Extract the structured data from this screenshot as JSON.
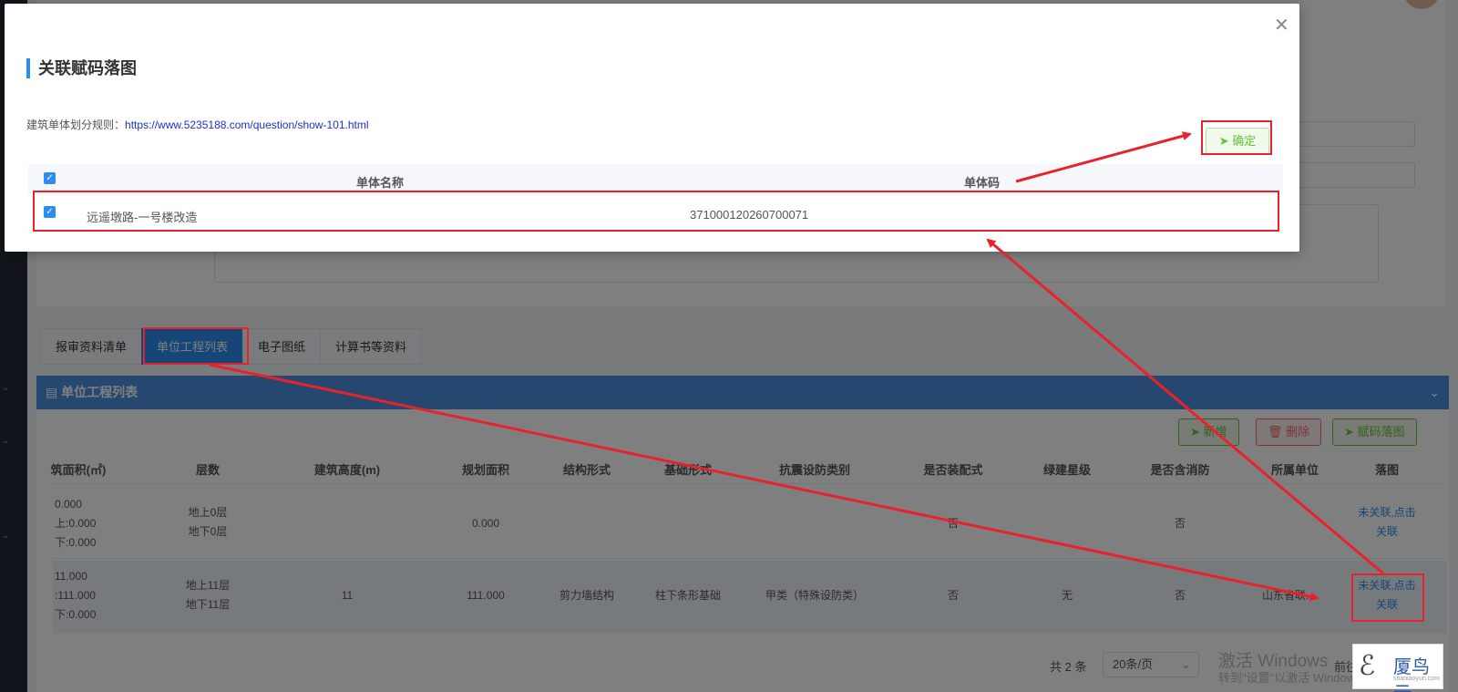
{
  "modal": {
    "title": "关联赋码落图",
    "close_icon": "close-icon",
    "rule_label": "建筑单体划分规则：",
    "rule_url": "https://www.5235188.com/question/show-101.html",
    "confirm_label": "确定",
    "confirm_icon": "send-icon",
    "columns": [
      "单体名称",
      "单体码"
    ],
    "rows": [
      {
        "name": "远遥墩路-一号楼改造",
        "code": "371000120260700071",
        "checked": true
      }
    ]
  },
  "tabs": [
    {
      "label": "报审资料清单",
      "active": false
    },
    {
      "label": "单位工程列表",
      "active": true
    },
    {
      "label": "电子图纸",
      "active": false
    },
    {
      "label": "计算书等资料",
      "active": false
    }
  ],
  "section": {
    "title": "单位工程列表",
    "icon": "list-icon",
    "collapse_icon": "chevron-down-icon"
  },
  "toolbar": {
    "add_label": "新增",
    "delete_label": "删除",
    "map_label": "赋码落图"
  },
  "table": {
    "columns": [
      "筑面积(㎡)",
      "层数",
      "建筑高度(m)",
      "规划面积",
      "结构形式",
      "基础形式",
      "抗震设防类别",
      "是否装配式",
      "绿建星级",
      "是否含消防",
      "所属单位",
      "落图"
    ],
    "rows": [
      {
        "area": [
          "0.000",
          "上:0.000",
          "下:0.000"
        ],
        "floors": [
          "地上0层",
          "地下0层"
        ],
        "height": "",
        "plan_area": "0.000",
        "structure": "",
        "foundation": "",
        "seismic": "",
        "prefab": "否",
        "green": "",
        "fire": "否",
        "unit": "",
        "map": [
          "未关联,点击",
          "关联"
        ]
      },
      {
        "area": [
          "11.000",
          ":111.000",
          "下:0.000"
        ],
        "floors": [
          "地上11层",
          "地下11层"
        ],
        "height": "11",
        "plan_area": "111.000",
        "structure": "剪力墙结构",
        "foundation": "柱下条形基础",
        "seismic": "甲类（特殊设防类）",
        "prefab": "否",
        "green": "无",
        "fire": "否",
        "unit": "山东省联...",
        "map": [
          "未关联,点击",
          "关联"
        ]
      }
    ]
  },
  "pager": {
    "total": "共 2 条",
    "page_size": "20条/页",
    "goto": "前往"
  },
  "watermark": {
    "line1": "激活 Windows",
    "line2": "转到\"设置\"以激活 Windows。"
  },
  "logo": {
    "text": "厦鸟云",
    "sub": "shaniaoyun.com"
  },
  "colors": {
    "accent": "#2d8cf0",
    "annotation": "#e8222c",
    "success": "#67c23a",
    "danger": "#f56c6c"
  }
}
